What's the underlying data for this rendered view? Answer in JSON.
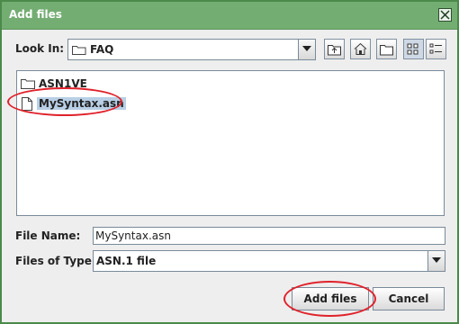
{
  "window": {
    "title": "Add files"
  },
  "look_in": {
    "label": "Look In:",
    "value": "FAQ"
  },
  "toolbar": {
    "icons": [
      "up-folder-icon",
      "home-icon",
      "new-folder-icon",
      "list-view-icon",
      "details-view-icon"
    ]
  },
  "files": [
    {
      "name": "ASN1VE",
      "type": "folder",
      "selected": false
    },
    {
      "name": "MySyntax.asn",
      "type": "file",
      "selected": true
    }
  ],
  "file_name": {
    "label": "File Name:",
    "value": "MySyntax.asn"
  },
  "files_of_type": {
    "label": "Files of Type:",
    "value": "ASN.1 file"
  },
  "buttons": {
    "add": "Add files",
    "cancel": "Cancel"
  },
  "colors": {
    "titlebar": "#73ad72",
    "highlight": "#e0212a",
    "selection": "#b8cfe5"
  }
}
